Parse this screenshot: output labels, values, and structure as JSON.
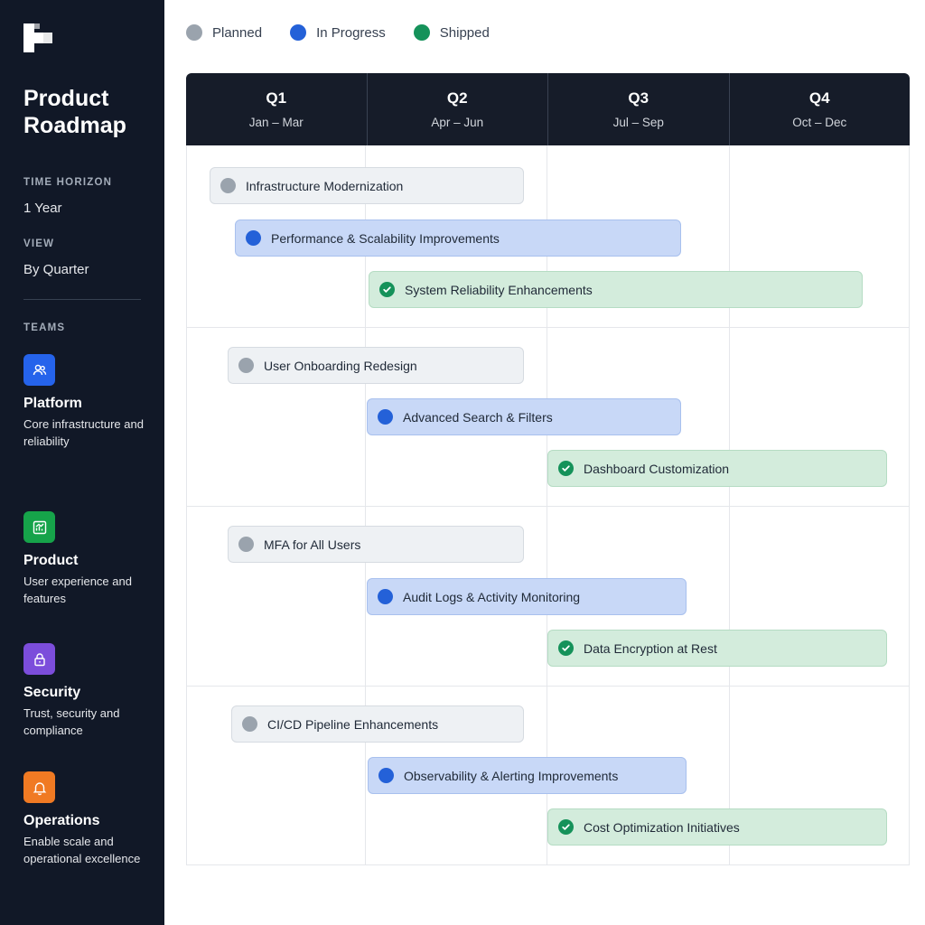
{
  "app": {
    "title": "Product Roadmap"
  },
  "sidebar": {
    "time_horizon": {
      "label": "TIME HORIZON",
      "value": "1 Year"
    },
    "view": {
      "label": "VIEW",
      "value": "By Quarter"
    },
    "teams_label": "TEAMS",
    "teams": [
      {
        "name": "Platform",
        "desc": "Core infrastructure and reliability",
        "icon": "users-icon",
        "color": "#2563eb"
      },
      {
        "name": "Product",
        "desc": "User experience and features",
        "icon": "chart-icon",
        "color": "#16a34a"
      },
      {
        "name": "Security",
        "desc": "Trust, security and compliance",
        "icon": "lock-icon",
        "color": "#7c4ddb"
      },
      {
        "name": "Operations",
        "desc": "Enable scale and operational excellence",
        "icon": "bell-icon",
        "color": "#f07a23"
      }
    ]
  },
  "legend": [
    {
      "label": "Planned",
      "status": "planned",
      "color": "#9aa3ad"
    },
    {
      "label": "In Progress",
      "status": "progress",
      "color": "#2461d8"
    },
    {
      "label": "Shipped",
      "status": "shipped",
      "color": "#15925a"
    }
  ],
  "quarters": [
    {
      "name": "Q1",
      "range": "Jan – Mar"
    },
    {
      "name": "Q2",
      "range": "Apr – Jun"
    },
    {
      "name": "Q3",
      "range": "Jul – Sep"
    },
    {
      "name": "Q4",
      "range": "Oct – Dec"
    }
  ],
  "items": [
    {
      "label": "Infrastructure Modernization",
      "status": "planned"
    },
    {
      "label": "Performance & Scalability Improvements",
      "status": "progress"
    },
    {
      "label": "System Reliability Enhancements",
      "status": "shipped"
    },
    {
      "label": "User Onboarding Redesign",
      "status": "planned"
    },
    {
      "label": "Advanced Search & Filters",
      "status": "progress"
    },
    {
      "label": "Dashboard Customization",
      "status": "shipped"
    },
    {
      "label": "MFA for All Users",
      "status": "planned"
    },
    {
      "label": "Audit Logs & Activity Monitoring",
      "status": "progress"
    },
    {
      "label": "Data Encryption at Rest",
      "status": "shipped"
    },
    {
      "label": "CI/CD Pipeline Enhancements",
      "status": "planned"
    },
    {
      "label": "Observability & Alerting Improvements",
      "status": "progress"
    },
    {
      "label": "Cost Optimization Initiatives",
      "status": "shipped"
    }
  ]
}
